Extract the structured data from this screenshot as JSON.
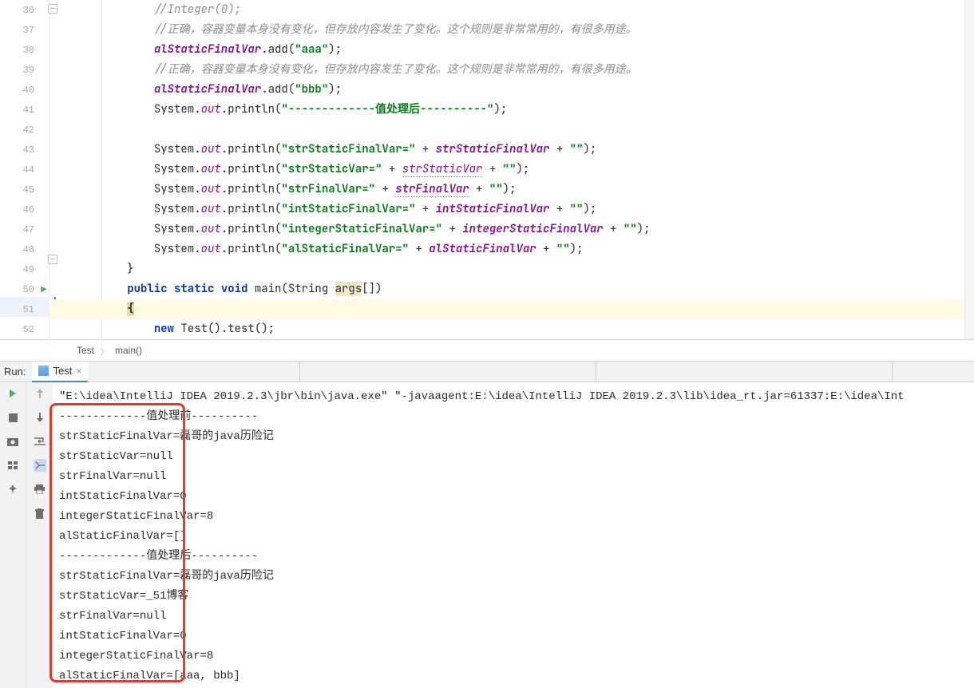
{
  "gutter": [
    "36",
    "37",
    "38",
    "39",
    "40",
    "41",
    "42",
    "43",
    "44",
    "45",
    "46",
    "47",
    "48",
    "49",
    "50",
    "51",
    "52"
  ],
  "runMarkerLine": 50,
  "code": {
    "l36": "//Integer(0);",
    "l37": "//正确，容器变量本身没有变化，但存放内容发生了变化。这个规则是非常常用的，有很多用途。",
    "l38_a": "alStaticFinalVar",
    "l38_b": ".add(",
    "l38_c": "\"aaa\"",
    "l38_d": ");",
    "l39": "//正确，容器变量本身没有变化，但存放内容发生了变化。这个规则是非常常用的，有很多用途。",
    "l40_a": "alStaticFinalVar",
    "l40_b": ".add(",
    "l40_c": "\"bbb\"",
    "l40_d": ");",
    "l41_a": "System.",
    "l41_b": "out",
    "l41_c": ".println(",
    "l41_d": "\"-------------值处理后----------\"",
    "l41_e": ");",
    "l43_a": "System.",
    "l43_b": "out",
    "l43_c": ".println(",
    "l43_d": "\"strStaticFinalVar=\"",
    "l43_e": " + ",
    "l43_f": "strStaticFinalVar",
    "l43_g": " + ",
    "l43_h": "\"\"",
    "l43_i": ");",
    "l44_a": "System.",
    "l44_b": "out",
    "l44_c": ".println(",
    "l44_d": "\"strStaticVar=\"",
    "l44_e": " + ",
    "l44_f": "strStaticVar",
    "l44_g": " + ",
    "l44_h": "\"\"",
    "l44_i": ");",
    "l45_a": "System.",
    "l45_b": "out",
    "l45_c": ".println(",
    "l45_d": "\"strFinalVar=\"",
    "l45_e": " + ",
    "l45_f": "strFinalVar",
    "l45_g": " + ",
    "l45_h": "\"\"",
    "l45_i": ");",
    "l46_a": "System.",
    "l46_b": "out",
    "l46_c": ".println(",
    "l46_d": "\"intStaticFinalVar=\"",
    "l46_e": " + ",
    "l46_f": "intStaticFinalVar",
    "l46_g": " + ",
    "l46_h": "\"\"",
    "l46_i": ");",
    "l47_a": "System.",
    "l47_b": "out",
    "l47_c": ".println(",
    "l47_d": "\"integerStaticFinalVar=\"",
    "l47_e": " + ",
    "l47_f": "integerStaticFinalVar",
    "l47_g": " + ",
    "l47_h": "\"\"",
    "l47_i": ");",
    "l48_a": "System.",
    "l48_b": "out",
    "l48_c": ".println(",
    "l48_d": "\"alStaticFinalVar=\"",
    "l48_e": " + ",
    "l48_f": "alStaticFinalVar",
    "l48_g": " + ",
    "l48_h": "\"\"",
    "l48_i": ");",
    "l49": "}",
    "l50_a": "public",
    "l50_b": " static",
    "l50_c": " void",
    "l50_d": " main(String ",
    "l50_e": "args",
    "l50_f": "[])",
    "l51": "{",
    "l52_a": "new",
    "l52_b": " Test().test();"
  },
  "breadcrumb": {
    "c1": "Test",
    "c2": "main()"
  },
  "run": {
    "label": "Run:",
    "tab": "Test"
  },
  "console": {
    "cmd_a": "\"E:\\idea\\IntelliJ IDEA 2019.2.3\\jbr\\bin\\java.exe\"",
    "cmd_b": " \"-javaagent:E:\\idea\\IntelliJ IDEA 2019.2.3\\lib\\idea_rt.jar=61337:E:\\idea\\Int",
    "l1": "-------------值处理前----------",
    "l2": "strStaticFinalVar=磊哥的java历险记",
    "l3": "strStaticVar=null",
    "l4": "strFinalVar=null",
    "l5": "intStaticFinalVar=0",
    "l6": "integerStaticFinalVar=8",
    "l7": "alStaticFinalVar=[]",
    "l8": "-------------值处理后----------",
    "l9": "strStaticFinalVar=磊哥的java历险记",
    "l10": "strStaticVar=_51博客",
    "l11": "strFinalVar=null",
    "l12": "intStaticFinalVar=0",
    "l13": "integerStaticFinalVar=8",
    "l14": "alStaticFinalVar=[aaa, bbb]"
  }
}
